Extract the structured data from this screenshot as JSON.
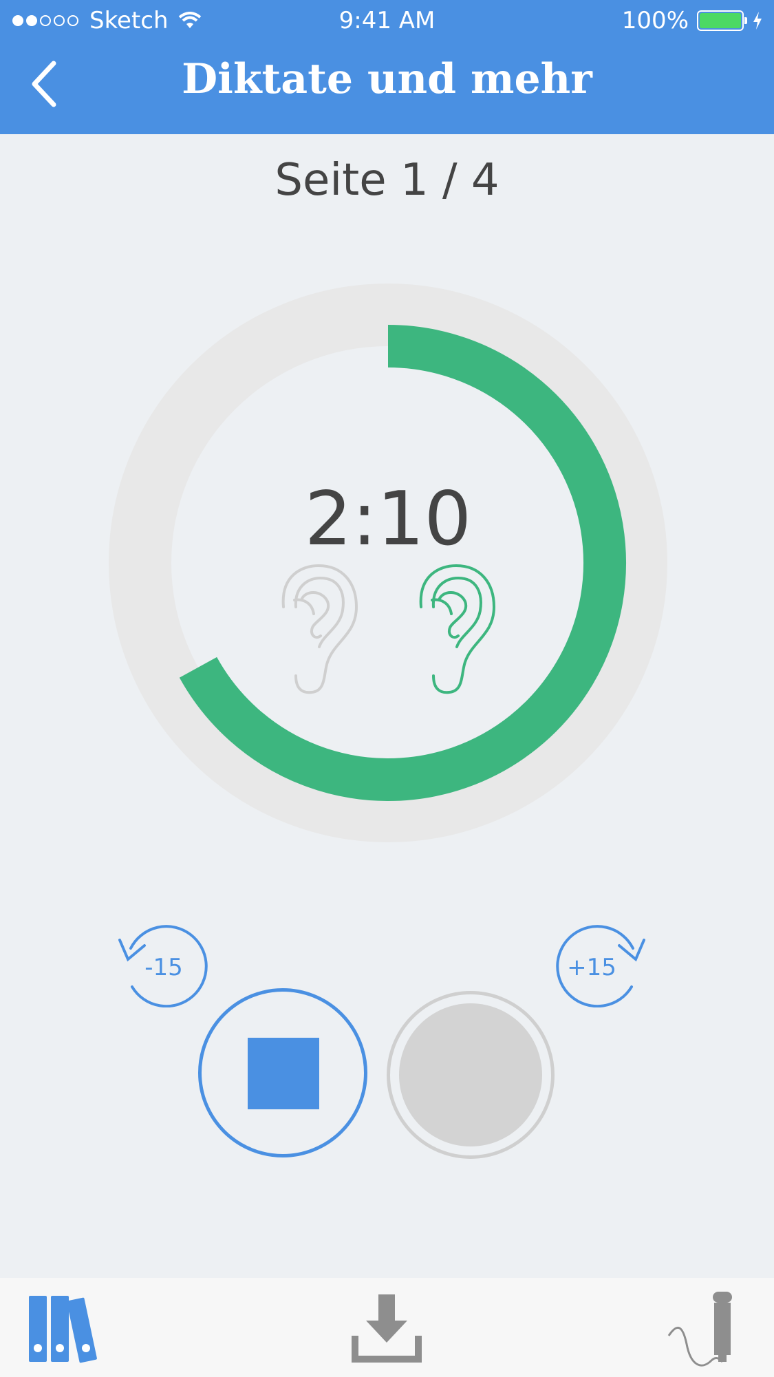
{
  "status_bar": {
    "carrier": "Sketch",
    "time": "9:41 AM",
    "battery": "100%"
  },
  "header": {
    "title": "Diktate und mehr"
  },
  "page_indicator": "Seite 1 / 4",
  "player": {
    "timer": "2:10",
    "progress": 0.67,
    "skip_back_label": "-15",
    "skip_forward_label": "+15"
  },
  "icons": {
    "back": "chevron-left-icon",
    "ear_inactive": "ear-icon",
    "ear_active": "ear-icon",
    "skip_back": "rotate-ccw-icon",
    "skip_forward": "rotate-cw-icon",
    "stop": "stop-icon",
    "record": "record-icon",
    "library": "books-icon",
    "download": "download-icon",
    "dictation": "microphone-icon"
  },
  "colors": {
    "brand": "#4a90e2",
    "progress": "#3db67f",
    "track": "#e8e8e8",
    "inactive": "#cfcfcf"
  }
}
